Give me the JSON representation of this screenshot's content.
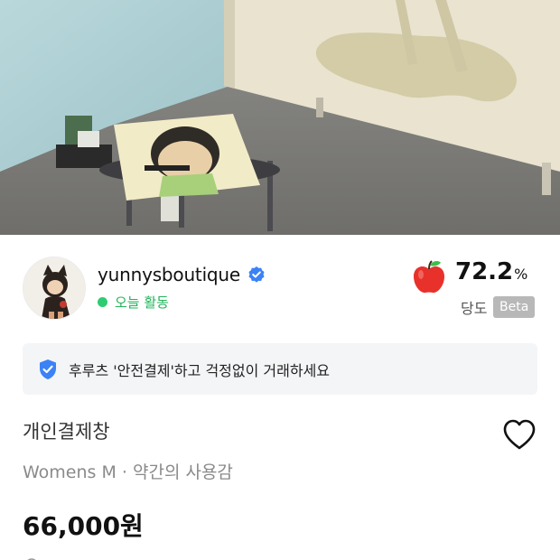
{
  "seller": {
    "name": "yunnysboutique",
    "activity": "오늘 활동",
    "score_value": "72.2",
    "score_unit": "%",
    "score_label": "당도",
    "beta_badge": "Beta"
  },
  "safe_banner": {
    "text": "후루츠 '안전결제'하고 걱정없이 거래하세요"
  },
  "product": {
    "title": "개인결제창",
    "meta": "Womens M · 약간의 사용감",
    "price": "66,000원"
  },
  "colors": {
    "online": "#2ecc71",
    "online_text": "#21b45a",
    "verified": "#3b82f6",
    "apple": "#e8312b",
    "beta_bg": "#b8b8b8",
    "banner_bg": "#f4f5f7"
  },
  "icons": [
    "verified-icon",
    "apple-icon",
    "shield-icon",
    "heart-icon"
  ]
}
